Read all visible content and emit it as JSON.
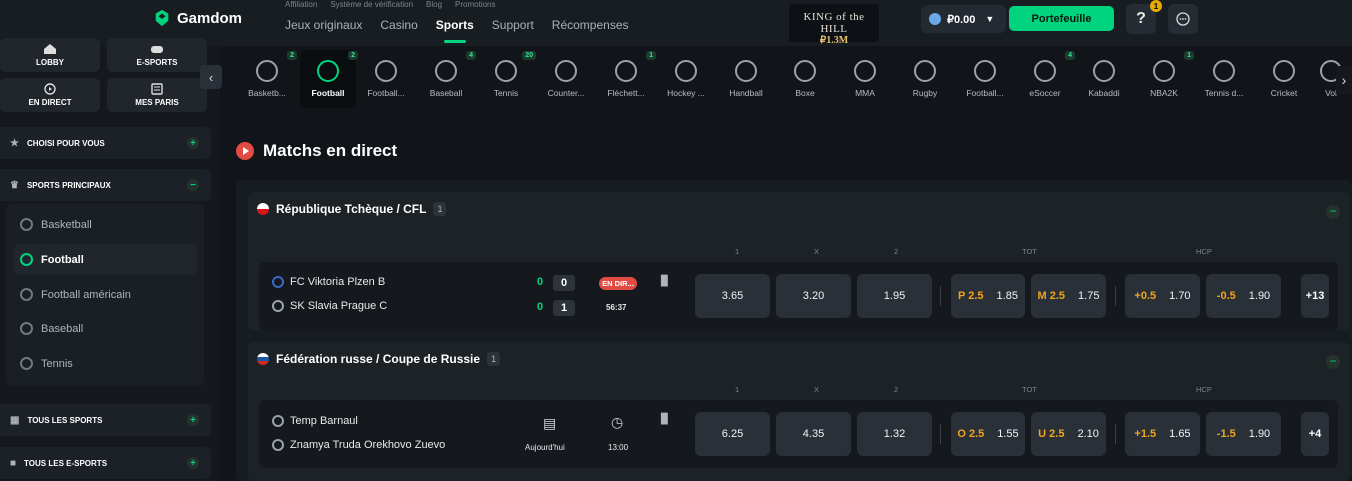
{
  "header": {
    "brand": "Gamdom",
    "sublinks": [
      "Affiliation",
      "Système de vérification",
      "Blog",
      "Promotions"
    ],
    "nav": [
      "Jeux originaux",
      "Casino",
      "Sports",
      "Support",
      "Récompenses"
    ],
    "promo_title": "KING of the HILL",
    "promo_amount": "₽1.3M",
    "balance": "₽0.00",
    "wallet_label": "Portefeuille",
    "help_label": "?",
    "notif_count": "1",
    "accent": "#00d47e"
  },
  "sidebar": {
    "buttons": [
      "LOBBY",
      "E-SPORTS",
      "EN DIRECT",
      "MES PARIS"
    ],
    "sections": [
      "CHOISI POUR VOUS",
      "SPORTS PRINCIPAUX",
      "TOUS LES SPORTS",
      "TOUS LES E-SPORTS"
    ],
    "sports": [
      "Basketball",
      "Football",
      "Football américain",
      "Baseball",
      "Tennis"
    ]
  },
  "sportbar": [
    {
      "label": "Basketb...",
      "count": "2"
    },
    {
      "label": "Football",
      "count": "2"
    },
    {
      "label": "Football...",
      "count": ""
    },
    {
      "label": "Baseball",
      "count": "4"
    },
    {
      "label": "Tennis",
      "count": "20"
    },
    {
      "label": "Counter...",
      "count": ""
    },
    {
      "label": "Fléchett...",
      "count": "1"
    },
    {
      "label": "Hockey ...",
      "count": ""
    },
    {
      "label": "Handball",
      "count": ""
    },
    {
      "label": "Boxe",
      "count": ""
    },
    {
      "label": "MMA",
      "count": ""
    },
    {
      "label": "Rugby",
      "count": ""
    },
    {
      "label": "Football...",
      "count": ""
    },
    {
      "label": "eSoccer",
      "count": "4"
    },
    {
      "label": "Kabaddi",
      "count": ""
    },
    {
      "label": "NBA2K",
      "count": "1"
    },
    {
      "label": "Tennis d...",
      "count": ""
    },
    {
      "label": "Cricket",
      "count": ""
    },
    {
      "label": "Vol",
      "count": ""
    }
  ],
  "main": {
    "title": "Matchs en direct",
    "col_labels": [
      "1",
      "X",
      "2",
      "TOT",
      "HCP"
    ],
    "leagues": [
      {
        "name": "République Tchèque / CFL",
        "count": "1",
        "home": "FC Viktoria Plzen B",
        "away": "SK Slavia Prague C",
        "home_score": "0",
        "home_set": "0",
        "away_score": "0",
        "away_set": "1",
        "status": "EN DIR...",
        "time": "56:37",
        "odds": [
          "3.65",
          "3.20",
          "1.95"
        ],
        "tot": [
          {
            "lbl": "P 2.5",
            "val": "1.85"
          },
          {
            "lbl": "M 2.5",
            "val": "1.75"
          }
        ],
        "hcp": [
          {
            "lbl": "+0.5",
            "val": "1.70"
          },
          {
            "lbl": "-0.5",
            "val": "1.90"
          }
        ],
        "more": "+13"
      },
      {
        "name": "Fédération russe / Coupe de Russie",
        "count": "1",
        "home": "Temp Barnaul",
        "away": "Znamya Truda Orekhovo Zuevo",
        "date": "Aujourd'hui",
        "time": "13:00",
        "odds": [
          "6.25",
          "4.35",
          "1.32"
        ],
        "tot": [
          {
            "lbl": "O 2.5",
            "val": "1.55"
          },
          {
            "lbl": "U 2.5",
            "val": "2.10"
          }
        ],
        "hcp": [
          {
            "lbl": "+1.5",
            "val": "1.65"
          },
          {
            "lbl": "-1.5",
            "val": "1.90"
          }
        ],
        "more": "+4"
      }
    ]
  }
}
